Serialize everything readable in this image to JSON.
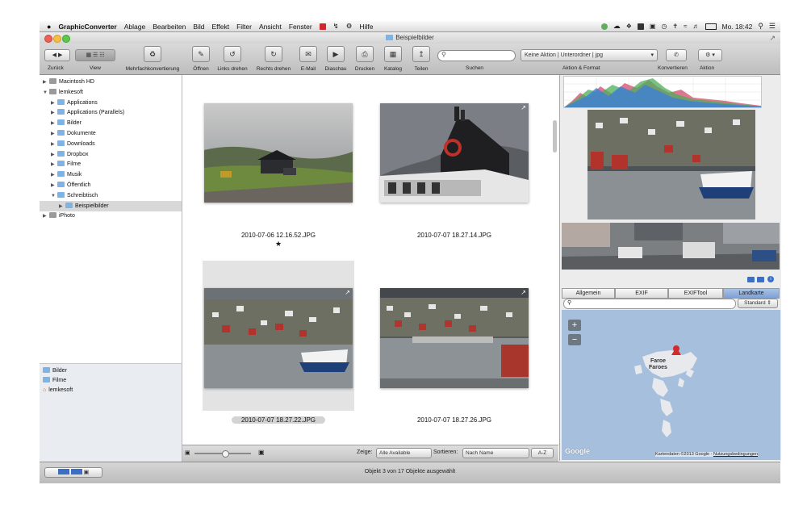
{
  "menubar": {
    "apple": "",
    "app_name": "GraphicConverter",
    "items": [
      "Ablage",
      "Bearbeiten",
      "Bild",
      "Effekt",
      "Filter",
      "Ansicht",
      "Fenster",
      "Hilfe"
    ],
    "clock": "Mo. 18:42"
  },
  "window": {
    "title": "Beispielbilder"
  },
  "toolbar": {
    "back_label": "Zurück",
    "view_label": "View",
    "buttons": [
      "Mehrfachkonvertierung",
      "Öffnen",
      "Links drehen",
      "Rechts drehen",
      "E-Mail",
      "Diaschau",
      "Drucken",
      "Katalog",
      "Teilen"
    ],
    "search_label": "Suchen",
    "search_placeholder": "",
    "action_select": "Keine Aktion | Unterordner | jpg",
    "action_label": "Aktion & Format",
    "convert_label": "Konvertieren",
    "action2_label": "Aktion"
  },
  "sidebar": {
    "tree": [
      {
        "label": "Macintosh HD",
        "indent": 0,
        "expanded": false
      },
      {
        "label": "lemkesoft",
        "indent": 0,
        "expanded": true
      },
      {
        "label": "Applications",
        "indent": 1,
        "expanded": false
      },
      {
        "label": "Applications (Parallels)",
        "indent": 1,
        "expanded": false
      },
      {
        "label": "Bilder",
        "indent": 1,
        "expanded": false
      },
      {
        "label": "Dokumente",
        "indent": 1,
        "expanded": false
      },
      {
        "label": "Downloads",
        "indent": 1,
        "expanded": false
      },
      {
        "label": "Dropbox",
        "indent": 1,
        "expanded": false
      },
      {
        "label": "Filme",
        "indent": 1,
        "expanded": false
      },
      {
        "label": "Musik",
        "indent": 1,
        "expanded": false
      },
      {
        "label": "Öffentlich",
        "indent": 1,
        "expanded": false
      },
      {
        "label": "Schreibtisch",
        "indent": 1,
        "expanded": true
      },
      {
        "label": "Beispielbilder",
        "indent": 2,
        "expanded": false,
        "selected": true
      },
      {
        "label": "iPhoto",
        "indent": 0,
        "expanded": false
      }
    ],
    "favorites": [
      "Bilder",
      "Filme",
      "lemkesoft"
    ]
  },
  "browser": {
    "files": [
      {
        "name": "2010-07-06 12.16.52.JPG",
        "rating": "★"
      },
      {
        "name": "2010-07-07 18.27.14.JPG",
        "rating": ""
      },
      {
        "name": "2010-07-07 18.27.22.JPG",
        "rating": "",
        "selected": true
      },
      {
        "name": "2010-07-07 18.27.26.JPG",
        "rating": ""
      }
    ],
    "show_label": "Zeige:",
    "show_value": "Alle Available",
    "sort_label": "Sortieren:",
    "sort_value": "Nach Name",
    "sort_order": "A-Z"
  },
  "inspector": {
    "tabs": [
      "Allgemein",
      "EXIF",
      "EXIFTool",
      "Landkarte"
    ],
    "active_tab": "Landkarte",
    "map_style": "Standard",
    "map_label_line1": "Faroe",
    "map_label_line2": "Faroes",
    "map_credit": "Kartendaten ©2013 Google -",
    "map_terms": "Nutzungsbedingungen",
    "google_logo": "Google",
    "zoom_in": "+",
    "zoom_out": "−"
  },
  "status": {
    "text": "Objekt 3 von 17 Objekte ausgewählt"
  },
  "colors": {
    "selection": "#c9d6e6",
    "map_water": "#a5bfdd",
    "folder": "#7eb3e6"
  }
}
